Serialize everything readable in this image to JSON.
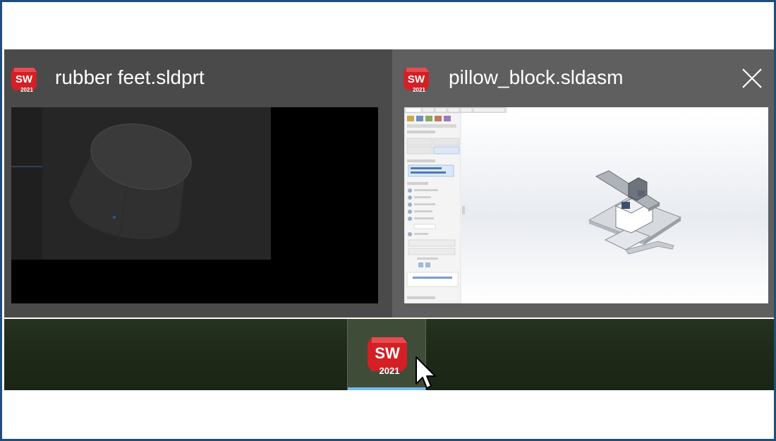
{
  "app": {
    "name": "SOLIDWORKS",
    "version": "2021"
  },
  "windows": [
    {
      "title": "rubber feet.sldprt",
      "active": false,
      "close_visible": false
    },
    {
      "title": "pillow_block.sldasm",
      "active": true,
      "close_visible": true
    }
  ],
  "icons": {
    "app_logo": "solidworks-logo-icon",
    "close": "close-icon",
    "cursor": "mouse-pointer-icon"
  },
  "colors": {
    "frame_border": "#1f4e7a",
    "strip_bg": "#4e4e4e",
    "active_card_bg": "#5f5f5f",
    "inactive_card_bg": "#4a4a4a",
    "taskbar_bg": "#1f2a18",
    "taskbar_active_indicator": "#76b9ed",
    "logo_red": "#d32027"
  }
}
